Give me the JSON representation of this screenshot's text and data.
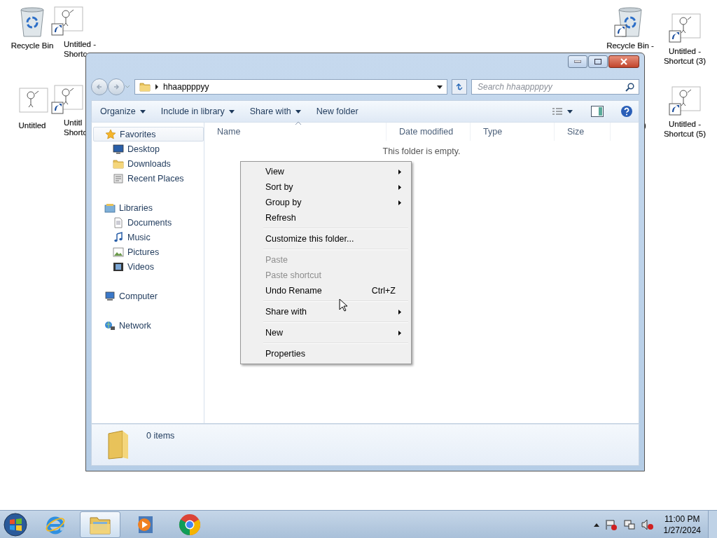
{
  "desktop_icons": [
    {
      "kind": "recycle-bin",
      "shortcut": false,
      "label": "Recycle Bin"
    },
    {
      "kind": "drawing",
      "shortcut": true,
      "label": "Untitled -\nShortc"
    },
    {
      "kind": "drawing",
      "shortcut": false,
      "label": "Untitled"
    },
    {
      "kind": "drawing",
      "shortcut": true,
      "label": "Untitl\nShortc"
    },
    {
      "kind": "recycle-bin",
      "shortcut": true,
      "label": "Recycle Bin -"
    },
    {
      "kind": "drawing",
      "shortcut": true,
      "label": "Untitled -\nShortcut (3)"
    },
    {
      "kind": "label",
      "label": ")"
    },
    {
      "kind": "drawing",
      "shortcut": true,
      "label": "Untitled -\nShortcut (5)"
    }
  ],
  "window": {
    "address": {
      "path": "hhaappppyy",
      "search_placeholder": "Search hhaappppyy"
    },
    "toolbar": [
      {
        "label": "Organize",
        "dropdown": true
      },
      {
        "label": "Include in library",
        "dropdown": true
      },
      {
        "label": "Share with",
        "dropdown": true
      },
      {
        "label": "New folder",
        "dropdown": false
      }
    ],
    "navigation": [
      {
        "label": "Favorites",
        "selected": true,
        "children": [
          {
            "label": "Desktop",
            "selected": false
          },
          {
            "label": "Downloads",
            "selected": false
          },
          {
            "label": "Recent Places",
            "selected": false
          }
        ]
      },
      {
        "label": "Libraries",
        "selected": false,
        "children": [
          {
            "label": "Documents",
            "selected": false
          },
          {
            "label": "Music",
            "selected": false
          },
          {
            "label": "Pictures",
            "selected": false
          },
          {
            "label": "Videos",
            "selected": false
          }
        ]
      },
      {
        "label": "Computer",
        "selected": false
      },
      {
        "label": "Network",
        "selected": false
      }
    ],
    "columns": [
      {
        "label": "Name",
        "sorted": true
      },
      {
        "label": "Date modified",
        "sorted": false
      },
      {
        "label": "Type",
        "sorted": false
      },
      {
        "label": "Size",
        "sorted": false
      }
    ],
    "empty_message": "This folder is empty.",
    "status": "0 items"
  },
  "context_menu": [
    {
      "kind": "item",
      "label": "View",
      "submenu": true,
      "disabled": false
    },
    {
      "kind": "item",
      "label": "Sort by",
      "submenu": true,
      "disabled": false
    },
    {
      "kind": "item",
      "label": "Group by",
      "submenu": true,
      "disabled": false
    },
    {
      "kind": "item",
      "label": "Refresh",
      "submenu": false,
      "disabled": false
    },
    {
      "kind": "separator"
    },
    {
      "kind": "item",
      "label": "Customize this folder...",
      "submenu": false,
      "disabled": false
    },
    {
      "kind": "separator"
    },
    {
      "kind": "item",
      "label": "Paste",
      "submenu": false,
      "disabled": true
    },
    {
      "kind": "item",
      "label": "Paste shortcut",
      "submenu": false,
      "disabled": true
    },
    {
      "kind": "item",
      "label": "Undo Rename",
      "shortcut": "Ctrl+Z",
      "submenu": false,
      "disabled": false
    },
    {
      "kind": "separator"
    },
    {
      "kind": "item",
      "label": "Share with",
      "submenu": true,
      "disabled": false
    },
    {
      "kind": "separator"
    },
    {
      "kind": "item",
      "label": "New",
      "submenu": true,
      "disabled": false
    },
    {
      "kind": "separator"
    },
    {
      "kind": "item",
      "label": "Properties",
      "submenu": false,
      "disabled": false
    }
  ],
  "taskbar": {
    "apps": [
      {
        "kind": "ie",
        "selected": false
      },
      {
        "kind": "explorer",
        "selected": true
      },
      {
        "kind": "media",
        "selected": false
      },
      {
        "kind": "chrome",
        "selected": false
      }
    ],
    "time": "11:00 PM",
    "date": "1/27/2024"
  }
}
